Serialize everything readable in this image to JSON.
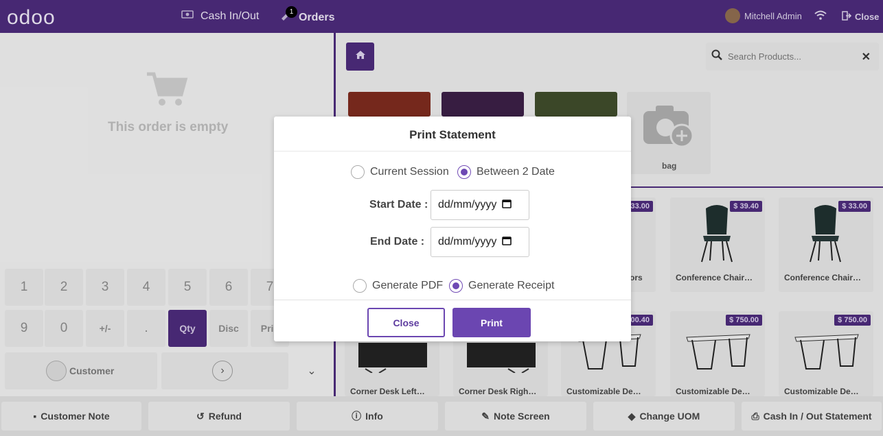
{
  "header": {
    "logo": "odoo",
    "cash_in_out": "Cash In/Out",
    "orders": "Orders",
    "orders_badge": "1",
    "user": "Mitchell Admin",
    "close": "Close"
  },
  "order": {
    "empty_text": "This order is empty"
  },
  "numpad": {
    "row1": [
      "1",
      "2",
      "3",
      "4",
      "5",
      "6",
      "7"
    ],
    "row2": [
      "9",
      "0",
      "+/-",
      ".",
      "Qty",
      "Disc",
      "Pric"
    ],
    "customer": "Customer"
  },
  "search": {
    "placeholder": "Search Products..."
  },
  "categories": {
    "bag_label": "bag"
  },
  "products": [
    {
      "name": "ors",
      "price": "$ 33.00"
    },
    {
      "name": "Conference Chair…",
      "price": "$ 39.40"
    },
    {
      "name": "Conference Chair…",
      "price": "$ 33.00"
    },
    {
      "name": "Corner Desk Left…",
      "price": ""
    },
    {
      "name": "Corner Desk Righ…",
      "price": ""
    },
    {
      "name": "Customizable De…",
      "price": "$ 300.40"
    },
    {
      "name": "Customizable De…",
      "price": "$ 750.00"
    },
    {
      "name": "Customizable De…",
      "price": "$ 750.00"
    }
  ],
  "bottom_bar": {
    "customer_note": "Customer Note",
    "refund": "Refund",
    "info": "Info",
    "note_screen": "Note Screen",
    "change_uom": "Change UOM",
    "cash_statement": "Cash In / Out Statement"
  },
  "modal": {
    "title": "Print Statement",
    "current_session": "Current Session",
    "between_dates": "Between 2 Date",
    "start_date_label": "Start Date :",
    "end_date_label": "End Date :",
    "start_date_value": "dd/mm/yyyy",
    "end_date_value": "dd/mm/yyyy",
    "generate_pdf": "Generate PDF",
    "generate_receipt": "Generate Receipt",
    "close_button": "Close",
    "print_button": "Print"
  },
  "colors": {
    "brand": "#4a2a78",
    "accent": "#6b46b1"
  }
}
